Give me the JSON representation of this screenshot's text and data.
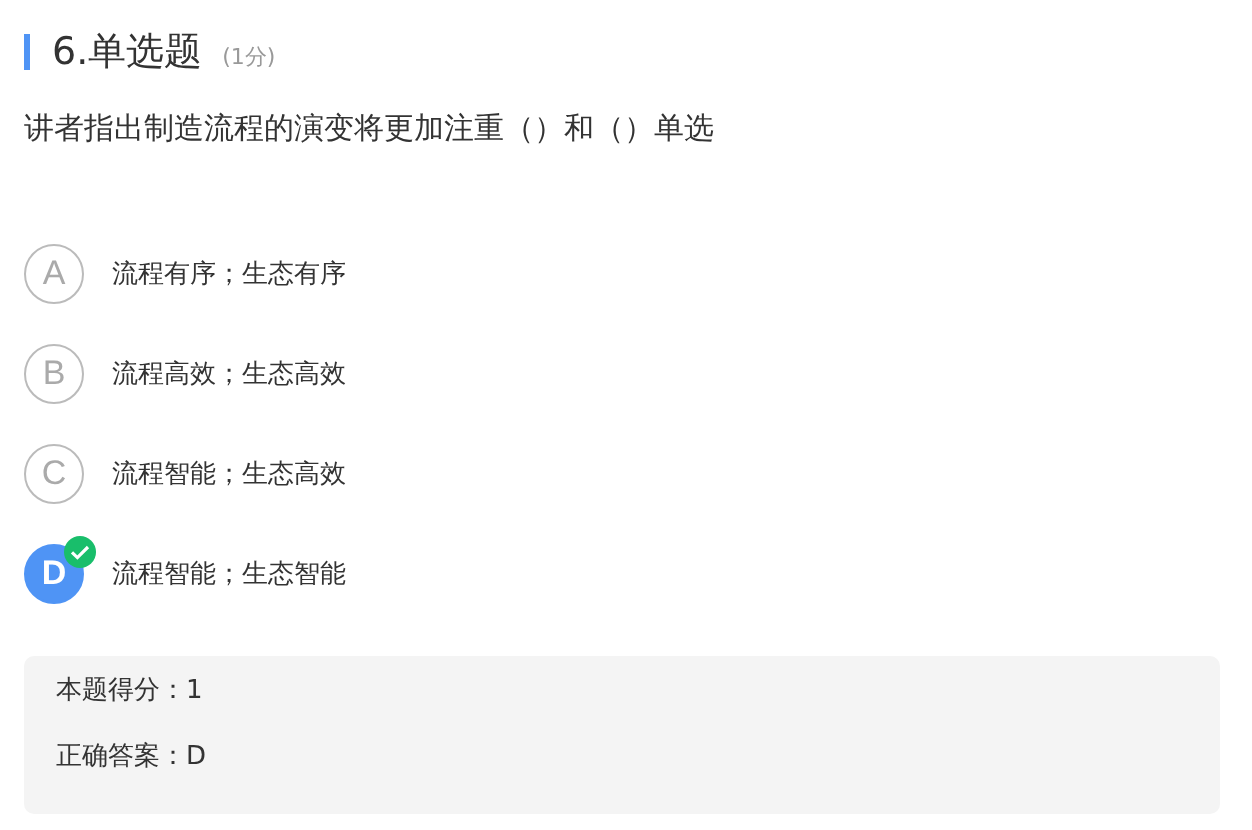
{
  "question": {
    "title": "6.单选题",
    "points": "(1分)",
    "text": "讲者指出制造流程的演变将更加注重（）和（）单选"
  },
  "options": [
    {
      "letter": "A",
      "text": "流程有序；生态有序",
      "selected": false
    },
    {
      "letter": "B",
      "text": "流程高效；生态高效",
      "selected": false
    },
    {
      "letter": "C",
      "text": "流程智能；生态高效",
      "selected": false
    },
    {
      "letter": "D",
      "text": "流程智能；生态智能",
      "selected": true
    }
  ],
  "result": [
    {
      "label": "本题得分：",
      "value": "1"
    },
    {
      "label": "正确答案：",
      "value": "D"
    }
  ]
}
